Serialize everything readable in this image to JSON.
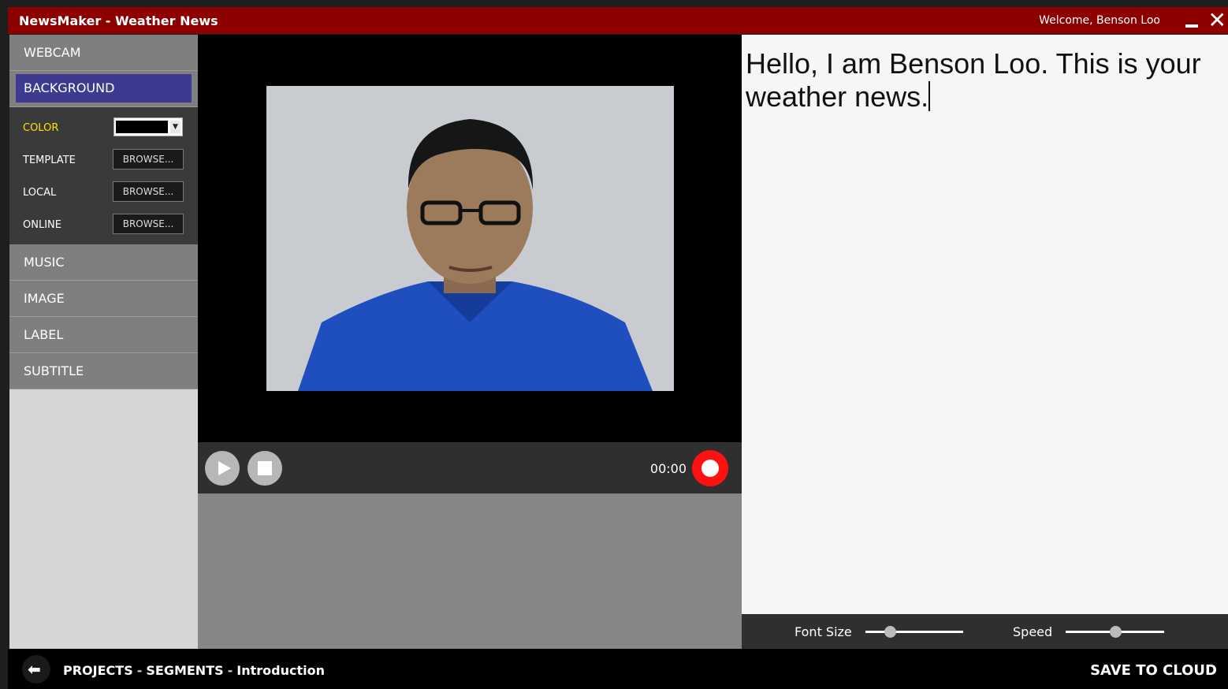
{
  "window": {
    "title": "NewsMaker - Weather News",
    "welcome": "Welcome,  Benson Loo"
  },
  "sidebar": {
    "items": [
      {
        "label": "WEBCAM"
      },
      {
        "label": "BACKGROUND",
        "active": true
      },
      {
        "label": "MUSIC"
      },
      {
        "label": "IMAGE"
      },
      {
        "label": "LABEL"
      },
      {
        "label": "SUBTITLE"
      }
    ],
    "background_options": {
      "color_label": "COLOR",
      "color_value": "#000000",
      "template_label": "TEMPLATE",
      "local_label": "LOCAL",
      "online_label": "ONLINE",
      "browse_label": "BROWSE..."
    }
  },
  "player": {
    "time": "00:00"
  },
  "script": {
    "text": "Hello, I am Benson Loo. This is your weather news."
  },
  "sliders": {
    "font_size": {
      "label": "Font Size",
      "value": 0.25
    },
    "speed": {
      "label": "Speed",
      "value": 0.5
    }
  },
  "footer": {
    "breadcrumb": [
      "PROJECTS",
      "SEGMENTS",
      "Introduction"
    ],
    "separator": "-",
    "save_label": "SAVE TO CLOUD"
  },
  "colors": {
    "titlebar": "#8c0000",
    "active_nav": "#3d3b8f",
    "record": "#ff1111",
    "highlight_label": "#ffe000"
  }
}
